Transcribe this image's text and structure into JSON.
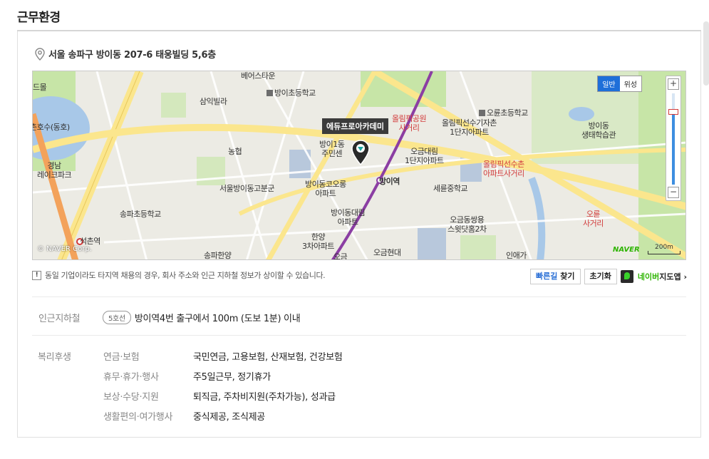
{
  "section": {
    "title": "근무환경"
  },
  "location": {
    "address": "서울 송파구 방이동 207-6 태웅빌딩 5,6층"
  },
  "map": {
    "marker_label": "에듀프로아카데미",
    "map_types": [
      "일반",
      "위성"
    ],
    "selected_map_type": "일반",
    "zoom_level_fraction": 0.8,
    "scale_label": "200m",
    "brand": "NAVER",
    "copyright": "© NAVER Corp.",
    "labels": [
      {
        "text": "베어스타운",
        "kind": "normal"
      },
      {
        "text": "드몰",
        "kind": "normal"
      },
      {
        "text": "방이초등학교",
        "kind": "normal"
      },
      {
        "text": "삼익빌라",
        "kind": "normal"
      },
      {
        "text": "올림픽공원\n사거리",
        "kind": "red"
      },
      {
        "text": "올림픽선수기자촌\n1단지아파트",
        "kind": "normal"
      },
      {
        "text": "오륜초등학교",
        "kind": "normal"
      },
      {
        "text": "촌호수(동호)",
        "kind": "normal"
      },
      {
        "text": "방이동\n생태학습관",
        "kind": "normal"
      },
      {
        "text": "농협",
        "kind": "normal"
      },
      {
        "text": "방이1동\n주민센",
        "kind": "normal"
      },
      {
        "text": "오금대림\n1단지아파트",
        "kind": "normal"
      },
      {
        "text": "올림픽선수촌\n아파트사거리",
        "kind": "red"
      },
      {
        "text": "경남\n레이크파크",
        "kind": "normal"
      },
      {
        "text": "방이역",
        "kind": "normal"
      },
      {
        "text": "서울방이동고분군",
        "kind": "normal"
      },
      {
        "text": "방이동코오롱\n아파트",
        "kind": "normal"
      },
      {
        "text": "세륜중학교",
        "kind": "normal"
      },
      {
        "text": "송파초등학교",
        "kind": "normal"
      },
      {
        "text": "방이동대림\n아파트",
        "kind": "normal"
      },
      {
        "text": "오륜\n사거리",
        "kind": "red"
      },
      {
        "text": "오금동쌍용\n스윗닷홈2차",
        "kind": "normal"
      },
      {
        "text": "한양\n3차아파트",
        "kind": "normal"
      },
      {
        "text": "석촌역",
        "kind": "normal"
      },
      {
        "text": "오금현대",
        "kind": "normal"
      },
      {
        "text": "송파한양",
        "kind": "normal"
      },
      {
        "text": "오금",
        "kind": "normal"
      },
      {
        "text": "인애가",
        "kind": "normal"
      }
    ]
  },
  "notice": {
    "icon": "exclamation-icon",
    "text": "동일 기업이라도 타지역 채용의 경우, 회사 주소와 인근 지하철 정보가 상이할 수 있습니다."
  },
  "actions": {
    "route_prefix": "빠른길",
    "route_suffix": "찾기",
    "reset": "초기화",
    "naver_brand": "네이버",
    "naver_suffix": "지도앱 ›"
  },
  "subway": {
    "label": "인근지하철",
    "line": "5호선",
    "text": "방이역4번 출구에서 100m (도보 1분) 이내"
  },
  "welfare": {
    "label": "복리후생",
    "items": [
      {
        "category": "연금·보험",
        "value": "국민연금, 고용보험, 산재보험, 건강보험"
      },
      {
        "category": "휴무·휴가·행사",
        "value": "주5일근무, 정기휴가"
      },
      {
        "category": "보상·수당·지원",
        "value": "퇴직금, 주차비지원(주차가능), 성과급"
      },
      {
        "category": "생활편의·여가행사",
        "value": "중식제공, 조식제공"
      }
    ]
  },
  "colors": {
    "accent_blue": "#1e6fd9",
    "naver_green": "#2db400",
    "subway_line": "#8b3ea3",
    "road_yellow": "#fbe68d",
    "road_orange": "#f3a25b",
    "park_green": "#c7e5a7",
    "water_blue": "#a8c8e8"
  }
}
